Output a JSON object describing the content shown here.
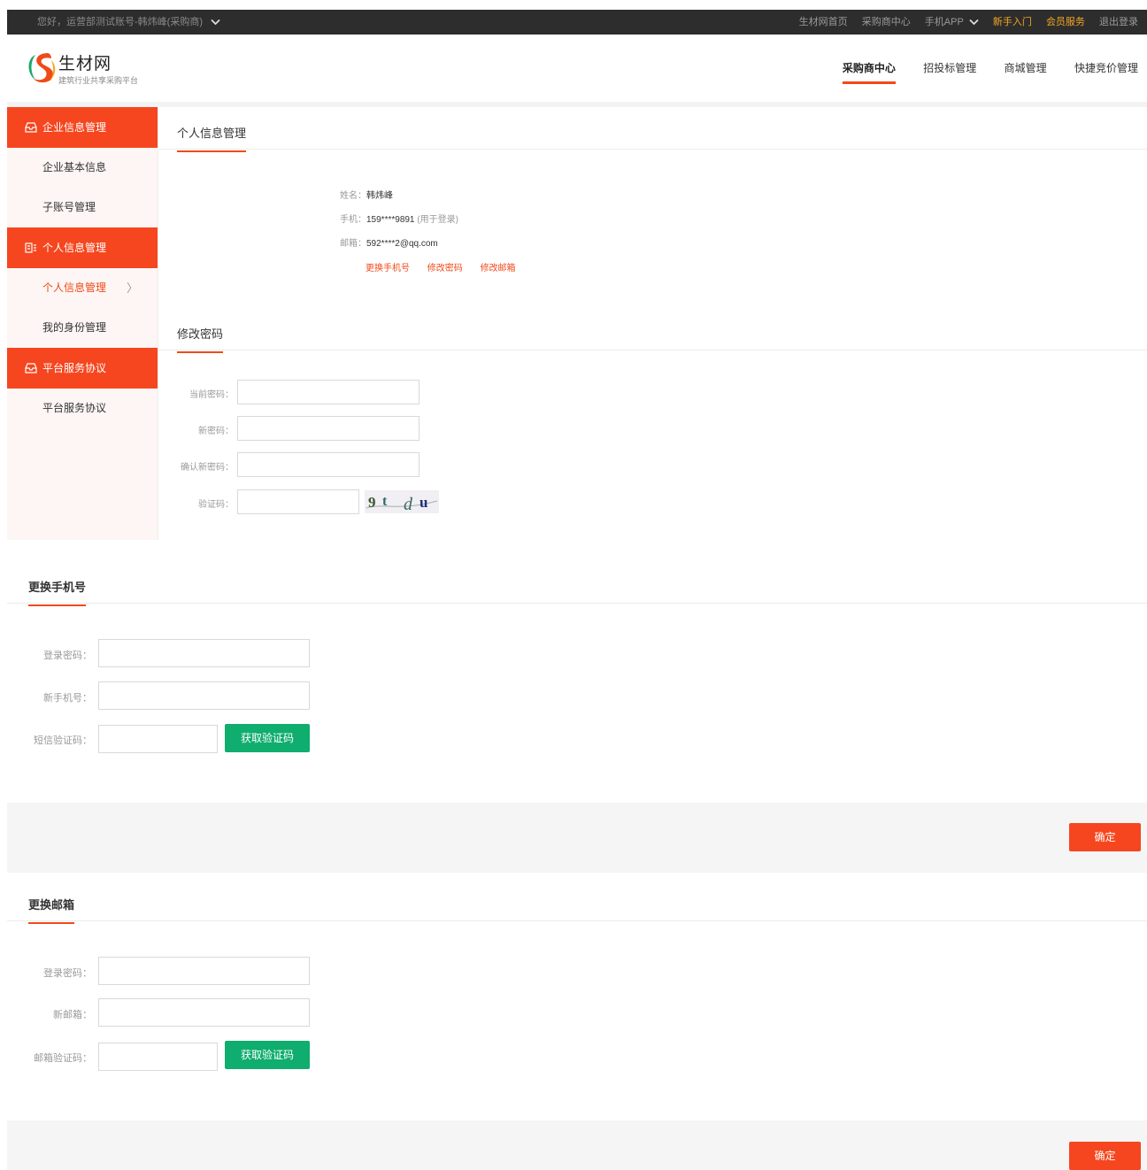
{
  "topbar": {
    "greeting": "您好，运营部测试账号-韩炜峰(采购商)",
    "links": [
      "生材网首页",
      "采购商中心",
      "手机APP",
      "新手入门",
      "会员服务",
      "退出登录"
    ]
  },
  "header": {
    "logo_title": "生材网",
    "logo_subtitle": "建筑行业共享采购平台",
    "nav": [
      "采购商中心",
      "招投标管理",
      "商城管理",
      "快捷竞价管理"
    ]
  },
  "sidebar": {
    "groups": [
      {
        "label": "企业信息管理",
        "items": [
          "企业基本信息",
          "子账号管理"
        ]
      },
      {
        "label": "个人信息管理",
        "items": [
          "个人信息管理",
          "我的身份管理"
        ]
      },
      {
        "label": "平台服务协议",
        "items": [
          "平台服务协议"
        ]
      }
    ],
    "arrow": "〉"
  },
  "profile": {
    "section_title": "个人信息管理",
    "name_label": "姓名：",
    "name_value": "韩炜峰",
    "phone_label": "手机：",
    "phone_value": "159****9891",
    "phone_note": "(用于登录)",
    "email_label": "邮箱：",
    "email_value": "592****2@qq.com",
    "actions": [
      "更换手机号",
      "修改密码",
      "修改邮箱"
    ]
  },
  "password": {
    "section_title": "修改密码",
    "current_label": "当前密码：",
    "new_label": "新密码：",
    "confirm_label": "确认新密码：",
    "captcha_label": "验证码：",
    "captcha_text": "9t du"
  },
  "phone_change": {
    "section_title": "更换手机号",
    "password_label": "登录密码：",
    "new_phone_label": "新手机号：",
    "sms_label": "短信验证码：",
    "get_code": "获取验证码",
    "confirm": "确定"
  },
  "email_change": {
    "section_title": "更换邮箱",
    "password_label": "登录密码：",
    "new_email_label": "新邮箱：",
    "code_label": "邮箱验证码：",
    "get_code": "获取验证码",
    "confirm": "确定"
  },
  "colors": {
    "accent": "#f5461f",
    "green": "#0fad6e",
    "topbar": "#2d2d2d",
    "highlight": "#f5a623"
  }
}
